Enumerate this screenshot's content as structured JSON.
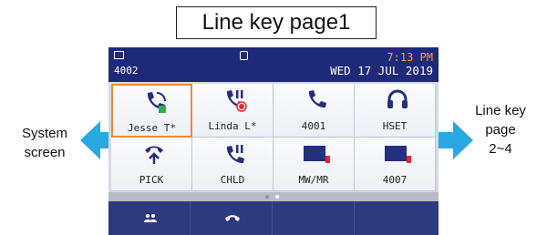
{
  "title": "Line key page1",
  "left_label": [
    "System",
    "screen"
  ],
  "right_label": [
    "Line key",
    "page",
    "2~4"
  ],
  "status_bar": {
    "extension": "4002",
    "time": "7:13 PM",
    "date": "WED 17 JUL 2019"
  },
  "line_keys": [
    {
      "label": "Jesse T*",
      "icon": "phone-busy-icon"
    },
    {
      "label": "Linda L*",
      "icon": "phone-hold-icon"
    },
    {
      "label": "4001",
      "icon": "phone-icon"
    },
    {
      "label": "HSET",
      "icon": "headset-icon"
    },
    {
      "label": "PICK",
      "icon": "pickup-icon"
    },
    {
      "label": "CHLD",
      "icon": "call-hold-icon"
    },
    {
      "label": "MW/MR",
      "icon": "message-icon"
    },
    {
      "label": "4007",
      "icon": "line-icon"
    }
  ],
  "page_indicator": {
    "pages": 2,
    "current": 2
  },
  "soft_keys": [
    {
      "icon": "contacts-icon"
    },
    {
      "icon": "handset-icon"
    },
    {
      "icon": ""
    },
    {
      "icon": ""
    }
  ],
  "colors": {
    "status_bar": "#1d2a78",
    "time": "#ff9f2f",
    "arrow": "#29a8e2",
    "selected_border": "#e68b3f",
    "status_green": "#2db04b",
    "status_red": "#e8262e",
    "icon_blue": "#232f7f"
  }
}
